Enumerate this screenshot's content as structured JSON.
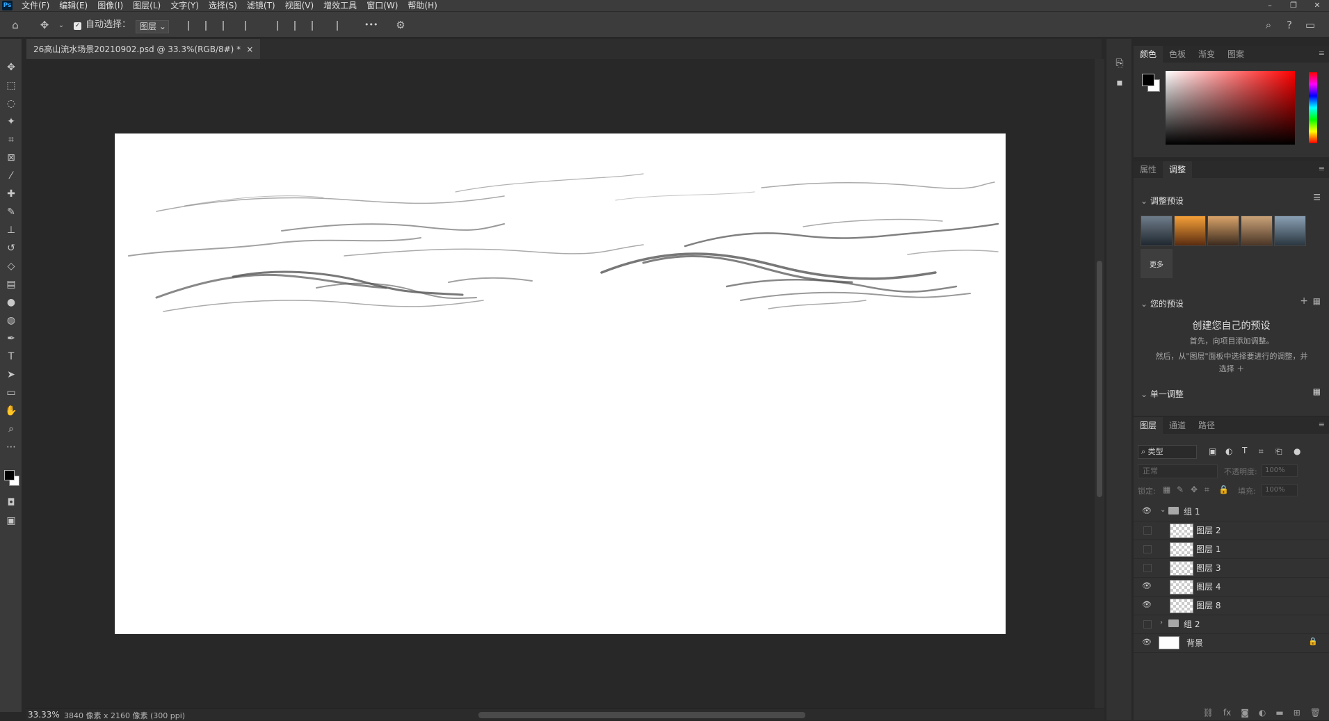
{
  "app": {
    "logo": "Ps"
  },
  "menu": [
    "文件(F)",
    "编辑(E)",
    "图像(I)",
    "图层(L)",
    "文字(Y)",
    "选择(S)",
    "滤镜(T)",
    "视图(V)",
    "增效工具",
    "窗口(W)",
    "帮助(H)"
  ],
  "window_controls": {
    "minimize": "–",
    "restore": "❐",
    "close": "✕"
  },
  "options": {
    "auto_select_label": "自动选择：",
    "auto_select_checked": true,
    "auto_select_target": "图层",
    "more_label": "•••"
  },
  "document": {
    "tab_title": "26高山流水场景20210902.psd @ 33.3%(RGB/8#) *",
    "tab_close": "×"
  },
  "status": {
    "zoom": "33.33%",
    "info": "3840 像素 x 2160 像素 (300 ppi)"
  },
  "color_panel": {
    "tabs": [
      "颜色",
      "色板",
      "渐变",
      "图案"
    ],
    "active_tab": 0,
    "foreground": "#000000",
    "background": "#ffffff",
    "hue": "#ff0000"
  },
  "adjust_panel": {
    "tabs": [
      "属性",
      "调整"
    ],
    "active_tab": 1,
    "presets_title": "调整预设",
    "more_label": "更多",
    "your_presets_title": "您的预设",
    "create_title": "创建您自己的预设",
    "create_line1": "首先，向项目添加调整。",
    "create_line2": "然后，从\"图层\"面板中选择要进行的调整，并",
    "create_line3": "选择 ＋",
    "single_adjust_title": "单一调整"
  },
  "layers_panel": {
    "tabs": [
      "图层",
      "通道",
      "路径"
    ],
    "active_tab": 0,
    "filter_label": "类型",
    "blend_mode": "正常",
    "opacity_label": "不透明度:",
    "opacity_value": "100%",
    "lock_label": "锁定:",
    "fill_label": "填充:",
    "fill_value": "100%",
    "layers": [
      {
        "name": "组 1",
        "type": "group",
        "visible": true,
        "expanded": true
      },
      {
        "name": "图层 2",
        "type": "layer",
        "visible": false
      },
      {
        "name": "图层 1",
        "type": "layer",
        "visible": false
      },
      {
        "name": "图层 3",
        "type": "layer",
        "visible": false
      },
      {
        "name": "图层 4",
        "type": "layer",
        "visible": true
      },
      {
        "name": "图层 8",
        "type": "layer",
        "visible": true
      },
      {
        "name": "组 2",
        "type": "group",
        "visible": false,
        "expanded": false
      },
      {
        "name": "背景",
        "type": "background",
        "visible": true,
        "locked": true
      }
    ]
  }
}
